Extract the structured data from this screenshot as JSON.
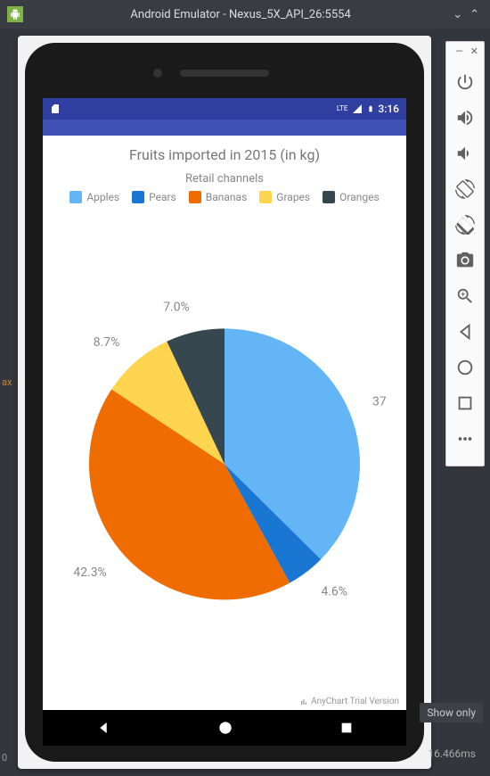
{
  "window": {
    "title": "Android Emulator - Nexus_5X_API_26:5554"
  },
  "side_toolbar": {
    "power": "power-icon",
    "volume_up": "volume-up-icon",
    "volume_down": "volume-down-icon",
    "rotate_left": "rotate-left-icon",
    "rotate_right": "rotate-right-icon",
    "camera": "camera-icon",
    "zoom": "zoom-icon",
    "back": "back-icon",
    "home": "home-circle-icon",
    "overview": "overview-icon",
    "more": "more-icon"
  },
  "status_bar": {
    "network": "LTE",
    "signal": "signal-icon",
    "battery": "battery-icon",
    "time": "3:16"
  },
  "chart_data": {
    "type": "pie",
    "title": "Fruits imported in 2015 (in kg)",
    "legend_title": "Retail channels",
    "series": [
      {
        "name": "Apples",
        "percent": 37.4,
        "label": "37",
        "color": "#64b5f6"
      },
      {
        "name": "Pears",
        "percent": 4.6,
        "label": "4.6%",
        "color": "#1976d2"
      },
      {
        "name": "Bananas",
        "percent": 42.3,
        "label": "42.3%",
        "color": "#ef6c00"
      },
      {
        "name": "Grapes",
        "percent": 8.7,
        "label": "8.7%",
        "color": "#ffd54f"
      },
      {
        "name": "Oranges",
        "percent": 7.0,
        "label": "7.0%",
        "color": "#37474f"
      }
    ],
    "watermark": "AnyChart Trial Version"
  },
  "footer": {
    "show_only": "Show only",
    "ms": "16.466ms",
    "ax": "ax",
    "zero": "0"
  }
}
